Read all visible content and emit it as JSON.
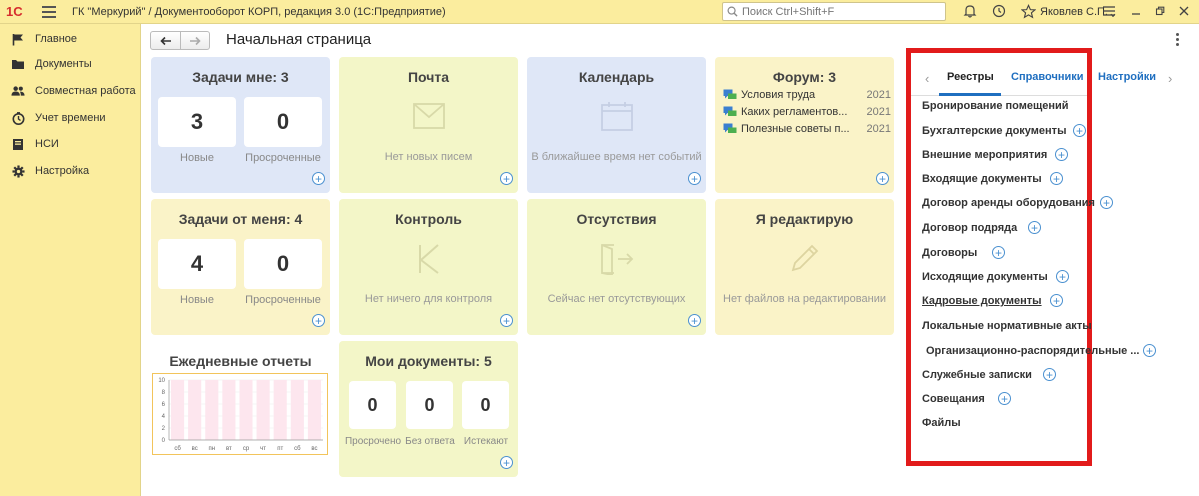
{
  "titlebar": {
    "logo": "1С",
    "title": "ГК \"Меркурий\" / Документооборот КОРП, редакция 3.0  (1С:Предприятие)",
    "search_placeholder": "Поиск Ctrl+Shift+F",
    "user": "Яковлев С.П."
  },
  "sidebar": {
    "items": [
      {
        "label": "Главное",
        "icon": "flag-icon"
      },
      {
        "label": "Документы",
        "icon": "folder-icon"
      },
      {
        "label": "Совместная работа",
        "icon": "people-icon"
      },
      {
        "label": "Учет времени",
        "icon": "clock-icon"
      },
      {
        "label": "НСИ",
        "icon": "book-icon"
      },
      {
        "label": "Настройка",
        "icon": "gear-icon"
      }
    ]
  },
  "main": {
    "page_title": "Начальная страница"
  },
  "tiles": {
    "tasks_to_me": {
      "title": "Задачи мне: 3",
      "new_value": "3",
      "new_label": "Новые",
      "overdue_value": "0",
      "overdue_label": "Просроченные"
    },
    "mail": {
      "title": "Почта",
      "empty": "Нет новых писем"
    },
    "calendar": {
      "title": "Календарь",
      "empty": "В ближайшее время нет событий"
    },
    "forum": {
      "title": "Форум: 3",
      "items": [
        {
          "text": "Условия труда",
          "year": "2021"
        },
        {
          "text": "Каких регламентов...",
          "year": "2021"
        },
        {
          "text": "Полезные советы п...",
          "year": "2021"
        }
      ]
    },
    "tasks_from_me": {
      "title": "Задачи от меня: 4",
      "new_value": "4",
      "new_label": "Новые",
      "overdue_value": "0",
      "overdue_label": "Просроченные"
    },
    "control": {
      "title": "Контроль",
      "empty": "Нет ничего для контроля"
    },
    "absence": {
      "title": "Отсутствия",
      "empty": "Сейчас нет отсутствующих"
    },
    "editing": {
      "title": "Я редактирую",
      "empty": "Нет файлов на редактировании"
    },
    "daily_reports": {
      "title": "Ежедневные отчеты"
    },
    "my_docs": {
      "title": "Мои документы: 5",
      "overdue_value": "0",
      "overdue_label": "Просрочено",
      "noanswer_value": "0",
      "noanswer_label": "Без ответа",
      "expiring_value": "0",
      "expiring_label": "Истекают"
    }
  },
  "chart_data": {
    "type": "bar",
    "categories": [
      "сб",
      "вс",
      "пн",
      "вт",
      "ср",
      "чт",
      "пт",
      "сб",
      "вс"
    ],
    "values": [
      0,
      0,
      0,
      0,
      0,
      0,
      0,
      0,
      0
    ],
    "yticks": [
      "0",
      "2",
      "4",
      "6",
      "8",
      "10"
    ],
    "ylim": [
      0,
      10
    ],
    "grid": true,
    "title": "",
    "xlabel": "",
    "ylabel": "",
    "bar_color": "#fde6ee",
    "border_color": "#f2c45b"
  },
  "right_panel": {
    "tabs": [
      "Реестры",
      "Справочники",
      "Настройки"
    ],
    "active_tab": "Реестры",
    "items": [
      {
        "label": "Бронирование помещений",
        "add": false
      },
      {
        "label": "Бухгалтерские документы",
        "add": true
      },
      {
        "label": "Внешние мероприятия",
        "add": true
      },
      {
        "label": "Входящие документы",
        "add": true
      },
      {
        "label": "Договор аренды оборудования",
        "add": true
      },
      {
        "label": "Договор подряда",
        "add": true
      },
      {
        "label": "Договоры",
        "add": true
      },
      {
        "label": "Исходящие документы",
        "add": true
      },
      {
        "label": "Кадровые документы",
        "add": true
      },
      {
        "label": "Локальные нормативные акты",
        "add": false
      },
      {
        "label": "Организационно-распорядительные ...",
        "add": true
      },
      {
        "label": "Служебные записки",
        "add": true
      },
      {
        "label": "Совещания",
        "add": true
      },
      {
        "label": "Файлы",
        "add": false
      }
    ]
  },
  "colors": {
    "panel_yellow": "#fbed9e",
    "tile_blue": "#dfe7f7",
    "tile_yellow": "#faf3c8",
    "tile_green": "#f3f6c8",
    "accent": "#1f6fc0",
    "highlight_border": "#e21b1b"
  }
}
